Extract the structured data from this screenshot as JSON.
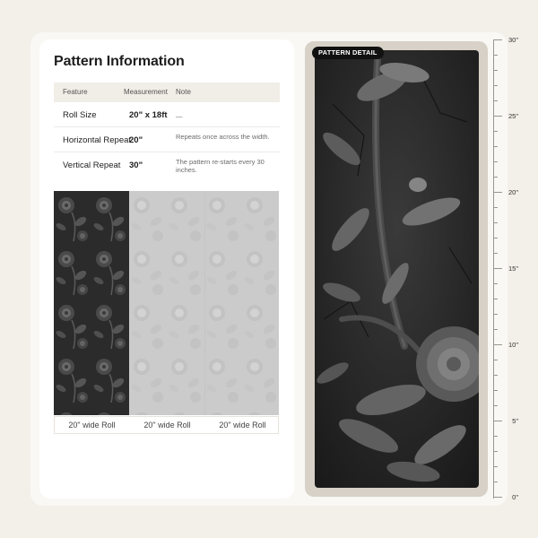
{
  "title": "Pattern Information",
  "table": {
    "headers": [
      "Feature",
      "Measurement",
      "Note"
    ],
    "rows": [
      {
        "feature": "Roll Size",
        "measurement": "20\" x 18ft",
        "note": "—"
      },
      {
        "feature": "Horizontal Repeat",
        "measurement": "20\"",
        "note": "Repeats once across the width."
      },
      {
        "feature": "Vertical Repeat",
        "measurement": "30\"",
        "note": "The pattern re-starts every 30 inches."
      }
    ]
  },
  "rolls": {
    "labels": [
      "20\" wide Roll",
      "20\" wide Roll",
      "20\" wide Roll"
    ]
  },
  "detail": {
    "badge": "PATTERN DETAIL"
  },
  "ruler": {
    "labels": [
      "30\"",
      "25\"",
      "20\"",
      "15\"",
      "10\"",
      "5\"",
      "0\""
    ]
  },
  "colors": {
    "background": "#f3efe9",
    "pattern_dark": "#2a2a2a",
    "pattern_faded": "#c9c9c9",
    "frame": "#d7d1c7"
  }
}
